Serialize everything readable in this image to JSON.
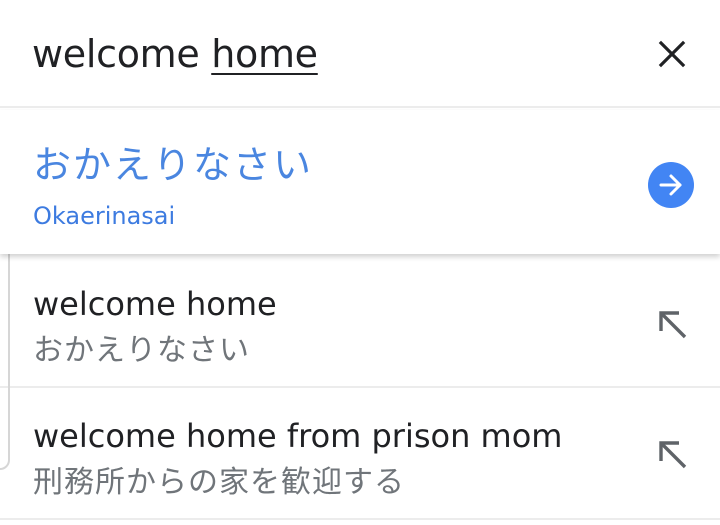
{
  "search": {
    "query_plain": "welcome ",
    "query_underlined": "home",
    "clear_icon": "close-icon"
  },
  "translation": {
    "text": "おかえりなさい",
    "romaji": "Okaerinasai",
    "go_icon": "arrow-right-circle-icon",
    "accent_color": "#4285f4"
  },
  "suggestions": [
    {
      "title": "welcome home",
      "translation": "おかえりなさい",
      "icon": "arrow-up-left-icon"
    },
    {
      "title": "welcome home from prison mom",
      "translation": "刑務所からの家を歓迎する",
      "icon": "arrow-up-left-icon"
    }
  ]
}
